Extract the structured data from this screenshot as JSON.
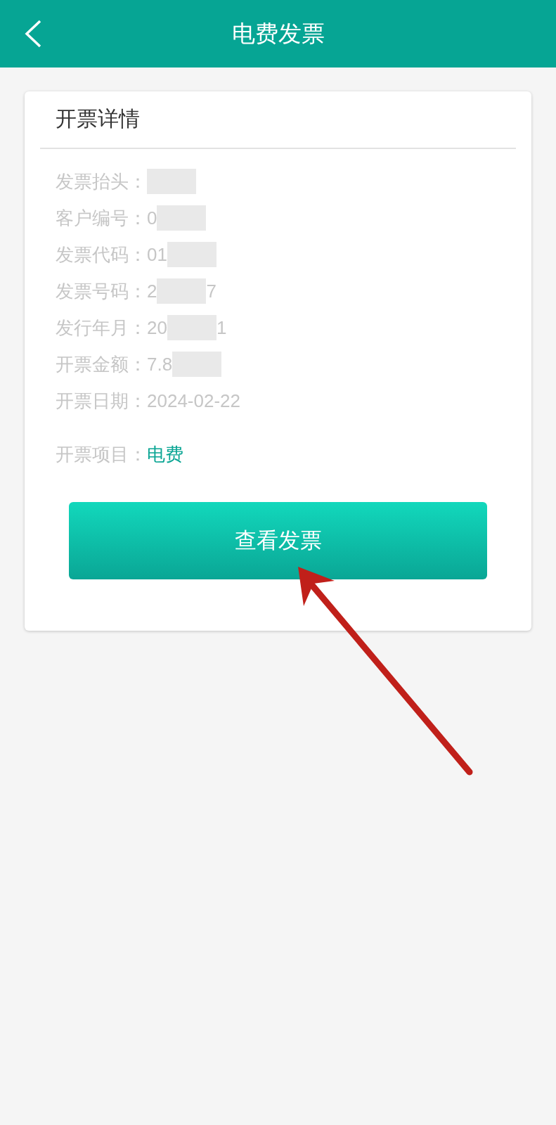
{
  "header": {
    "title": "电费发票"
  },
  "card": {
    "title": "开票详情",
    "fields": [
      {
        "label": "发票抬头：",
        "redacted": true
      },
      {
        "label": "客户编号：",
        "value": "0",
        "redacted": true
      },
      {
        "label": "发票代码：",
        "value": "01",
        "redacted": true
      },
      {
        "label": "发票号码：",
        "value": "2",
        "redacted": true,
        "tail": "7"
      },
      {
        "label": "发行年月：",
        "value": "20",
        "redacted": true,
        "tail": "1"
      },
      {
        "label": "开票金额：",
        "value": "7.8",
        "redacted": true
      },
      {
        "label": "开票日期：",
        "value": "2024-02-22",
        "redacted": false
      }
    ],
    "item": {
      "label": "开票项目：",
      "value": "电费"
    },
    "button": "查看发票"
  }
}
